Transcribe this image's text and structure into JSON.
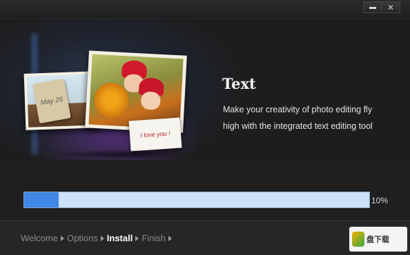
{
  "window": {
    "minimize_label": "",
    "close_label": "✕"
  },
  "hero": {
    "title": "Text",
    "description_line1": "Make your creativity of photo editing fly",
    "description_line2": "high with the integrated text editing tool",
    "tag_text": "May 26",
    "note_text": "I love you !"
  },
  "progress": {
    "percent_label": "10%",
    "fraction": 0.1
  },
  "steps": [
    {
      "label": "Welcome",
      "active": false
    },
    {
      "label": "Options",
      "active": false
    },
    {
      "label": "Install",
      "active": true
    },
    {
      "label": "Finish",
      "active": false
    }
  ],
  "watermark": {
    "text": "盘下载",
    "sub": ""
  },
  "colors": {
    "progress_fill": "#3f88e6",
    "progress_track": "#cde2f6"
  }
}
